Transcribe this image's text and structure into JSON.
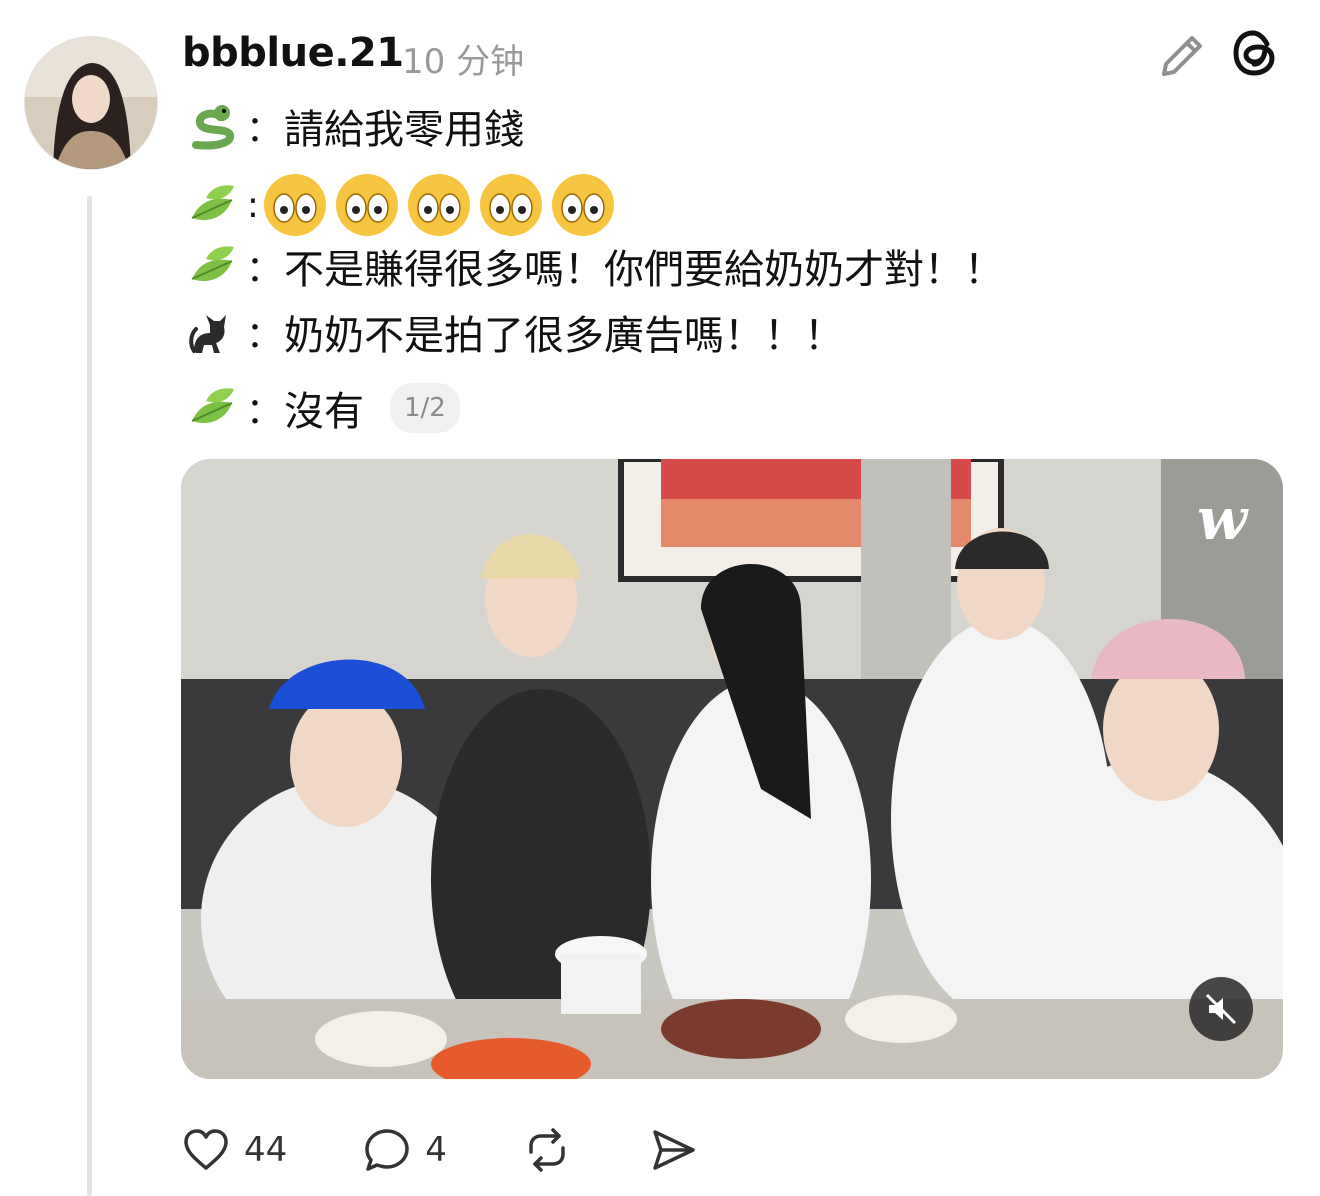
{
  "post": {
    "username": "bbblue.21",
    "timestamp": "10 分钟",
    "lines": [
      {
        "speaker_icon": "snake-emoji",
        "colon": "：",
        "text": "請給我零用錢"
      },
      {
        "speaker_icon": "leaf-emoji",
        "colon": ":",
        "emoji_icon": "flushed-face-emoji",
        "emoji_count": 5
      },
      {
        "speaker_icon": "leaf-emoji",
        "colon": "：",
        "text": "不是賺得很多嗎！你們要給奶奶才對！！"
      },
      {
        "speaker_icon": "black-cat-emoji",
        "colon": "：",
        "text": "奶奶不是拍了很多廣告嗎！！！"
      },
      {
        "speaker_icon": "leaf-emoji",
        "colon": "：",
        "text": "沒有"
      }
    ],
    "media_pager": "1/2",
    "media_logo": "w"
  },
  "actions": {
    "likes": "44",
    "replies": "4"
  },
  "colors": {
    "text": "#111111",
    "muted": "#9a9a9a",
    "thread_line": "#e3e3e3"
  }
}
